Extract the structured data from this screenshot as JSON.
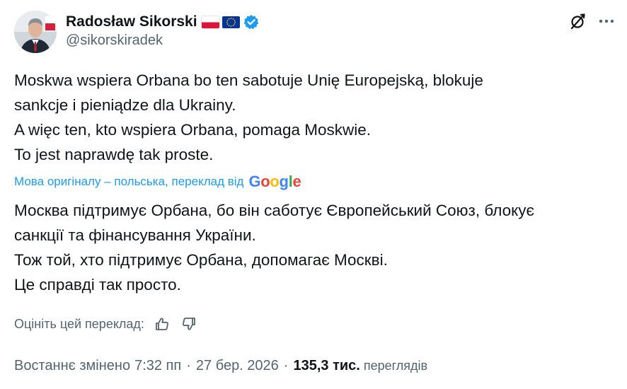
{
  "author": {
    "name": "Radosław Sikorski",
    "handle": "@sikorskiradek",
    "flags": [
      "flag-poland-icon",
      "flag-eu-icon"
    ],
    "verified_icon": "verified-badge-icon",
    "verified_color": "#1d9bf0"
  },
  "header_icons": [
    "grok-icon",
    "more-icon"
  ],
  "tweet": {
    "original_lines": [
      "Moskwa wspiera Orbana bo ten sabotuje Unię Europejską, blokuje",
      "sankcje i pieniądze dla Ukrainy.",
      "A więc ten, kto wspiera Orbana, pomaga Moskwie.",
      "To jest naprawdę tak proste."
    ],
    "translation_note": "Мова оригіналу – польська, переклад від",
    "translation_provider": "Google",
    "translated_lines": [
      "Москва підтримує Орбана, бо він саботує Європейський Союз, блокує",
      "санкції та фінансування України.",
      "Тож той, хто підтримує Орбана, допомагає Москві.",
      "Це справді так просто."
    ]
  },
  "rating": {
    "label": "Оцініть цей переклад:",
    "icons": [
      "thumbs-up-icon",
      "thumbs-down-icon"
    ]
  },
  "meta": {
    "edited_label": "Востаннє змінено",
    "time": "7:32 пп",
    "separator": "·",
    "date": "27 бер. 2026",
    "views_count": "135,3 тис.",
    "views_label": "переглядів"
  },
  "colors": {
    "text": "#0f1419",
    "secondary": "#536471",
    "link": "#1d9bf0"
  }
}
